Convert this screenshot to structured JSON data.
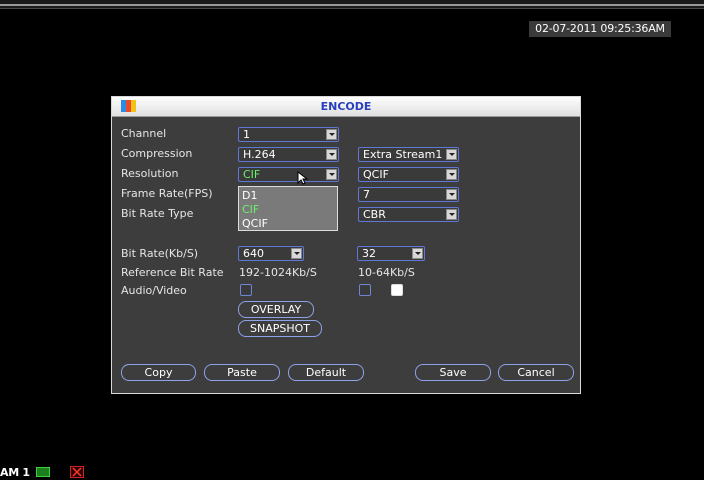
{
  "osd": {
    "timestamp": "02-07-2011 09:25:36AM",
    "camera_label": "AM 1"
  },
  "dialog": {
    "title": "ENCODE",
    "labels": {
      "channel": "Channel",
      "compression": "Compression",
      "resolution": "Resolution",
      "frame_rate": "Frame Rate(FPS)",
      "bit_rate_type": "Bit Rate Type",
      "bit_rate": "Bit Rate(Kb/S)",
      "reference_bit_rate": "Reference Bit Rate",
      "audio_video": "Audio/Video"
    },
    "main_stream": {
      "channel": "1",
      "compression": "H.264",
      "resolution": "CIF",
      "bit_rate": "640",
      "reference_bit_rate": "192-1024Kb/S"
    },
    "extra_stream": {
      "stream": "Extra Stream1",
      "resolution": "QCIF",
      "frame_rate": "7",
      "bit_rate_type": "CBR",
      "bit_rate": "32",
      "reference_bit_rate": "10-64Kb/S"
    },
    "resolution_options": [
      "D1",
      "CIF",
      "QCIF"
    ],
    "buttons": {
      "overlay": "OVERLAY",
      "snapshot": "SNAPSHOT",
      "copy": "Copy",
      "paste": "Paste",
      "default": "Default",
      "save": "Save",
      "cancel": "Cancel"
    }
  },
  "colors": {
    "title_text": "#2a3fbf",
    "field_border": "#5f78d6",
    "selected_text": "#6cf06c"
  }
}
